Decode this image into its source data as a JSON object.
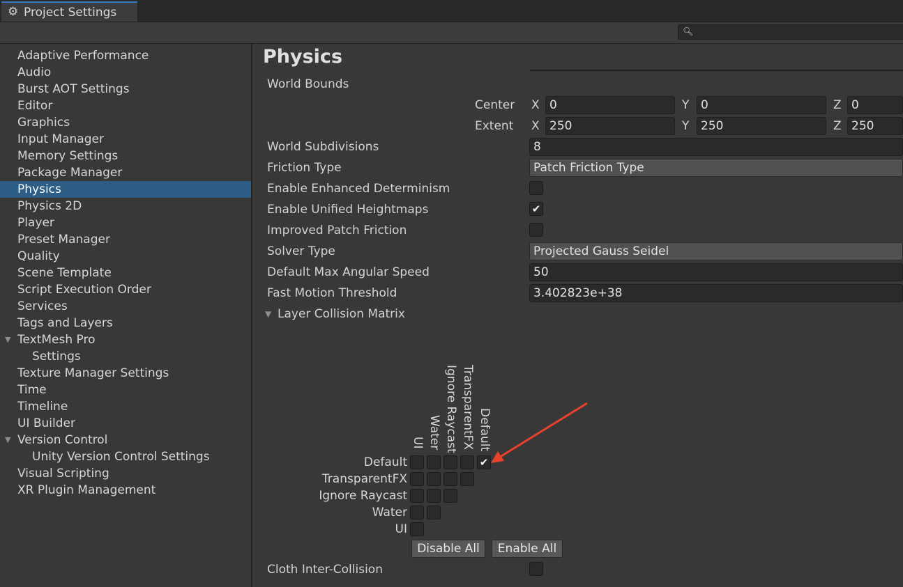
{
  "window": {
    "tab_title": "Project Settings",
    "tab_icon": "gear-icon"
  },
  "search": {
    "placeholder": "",
    "value": ""
  },
  "sidebar": {
    "items": [
      {
        "label": "Adaptive Performance"
      },
      {
        "label": "Audio"
      },
      {
        "label": "Burst AOT Settings"
      },
      {
        "label": "Editor"
      },
      {
        "label": "Graphics"
      },
      {
        "label": "Input Manager"
      },
      {
        "label": "Memory Settings"
      },
      {
        "label": "Package Manager"
      },
      {
        "label": "Physics",
        "selected": true
      },
      {
        "label": "Physics 2D"
      },
      {
        "label": "Player"
      },
      {
        "label": "Preset Manager"
      },
      {
        "label": "Quality"
      },
      {
        "label": "Scene Template"
      },
      {
        "label": "Script Execution Order"
      },
      {
        "label": "Services"
      },
      {
        "label": "Tags and Layers"
      },
      {
        "label": "TextMesh Pro",
        "expanded": true
      },
      {
        "label": "Settings",
        "child": true
      },
      {
        "label": "Texture Manager Settings"
      },
      {
        "label": "Time"
      },
      {
        "label": "Timeline"
      },
      {
        "label": "UI Builder"
      },
      {
        "label": "Version Control",
        "expanded": true
      },
      {
        "label": "Unity Version Control Settings",
        "child": true
      },
      {
        "label": "Visual Scripting"
      },
      {
        "label": "XR Plugin Management"
      }
    ]
  },
  "main": {
    "title": "Physics",
    "world_bounds": {
      "label": "World Bounds",
      "center_label": "Center",
      "extent_label": "Extent",
      "axis_x": "X",
      "axis_y": "Y",
      "axis_z": "Z",
      "center": {
        "x": "0",
        "y": "0",
        "z": "0"
      },
      "extent": {
        "x": "250",
        "y": "250",
        "z": "250"
      }
    },
    "world_subdivisions": {
      "label": "World Subdivisions",
      "value": "8"
    },
    "friction_type": {
      "label": "Friction Type",
      "value": "Patch Friction Type"
    },
    "enhanced_determinism": {
      "label": "Enable Enhanced Determinism",
      "checked": false
    },
    "unified_heightmaps": {
      "label": "Enable Unified Heightmaps",
      "checked": true,
      "mark": "✔"
    },
    "improved_patch_friction": {
      "label": "Improved Patch Friction",
      "checked": false
    },
    "solver_type": {
      "label": "Solver Type",
      "value": "Projected Gauss Seidel"
    },
    "max_angular_speed": {
      "label": "Default Max Angular Speed",
      "value": "50"
    },
    "fast_motion_threshold": {
      "label": "Fast Motion Threshold",
      "value": "3.402823e+38"
    },
    "layer_collision_matrix": {
      "label": "Layer Collision Matrix",
      "expanded": true,
      "column_layers": [
        "UI",
        "Water",
        "Ignore Raycast",
        "TransparentFX",
        "Default"
      ],
      "row_layers": [
        "Default",
        "TransparentFX",
        "Ignore Raycast",
        "Water",
        "UI"
      ],
      "checked_cells": [
        [
          "Default",
          "Default"
        ]
      ],
      "check_mark": "✔",
      "disable_all": "Disable All",
      "enable_all": "Enable All"
    },
    "cloth_inter_collision": {
      "label": "Cloth Inter-Collision",
      "checked": false
    }
  },
  "annotation": {
    "arrow_color": "#e8412c",
    "points_to": "Default/Default cell"
  },
  "colors": {
    "selection": "#2c5d87",
    "background": "#383838",
    "field": "#2a2a2a"
  }
}
